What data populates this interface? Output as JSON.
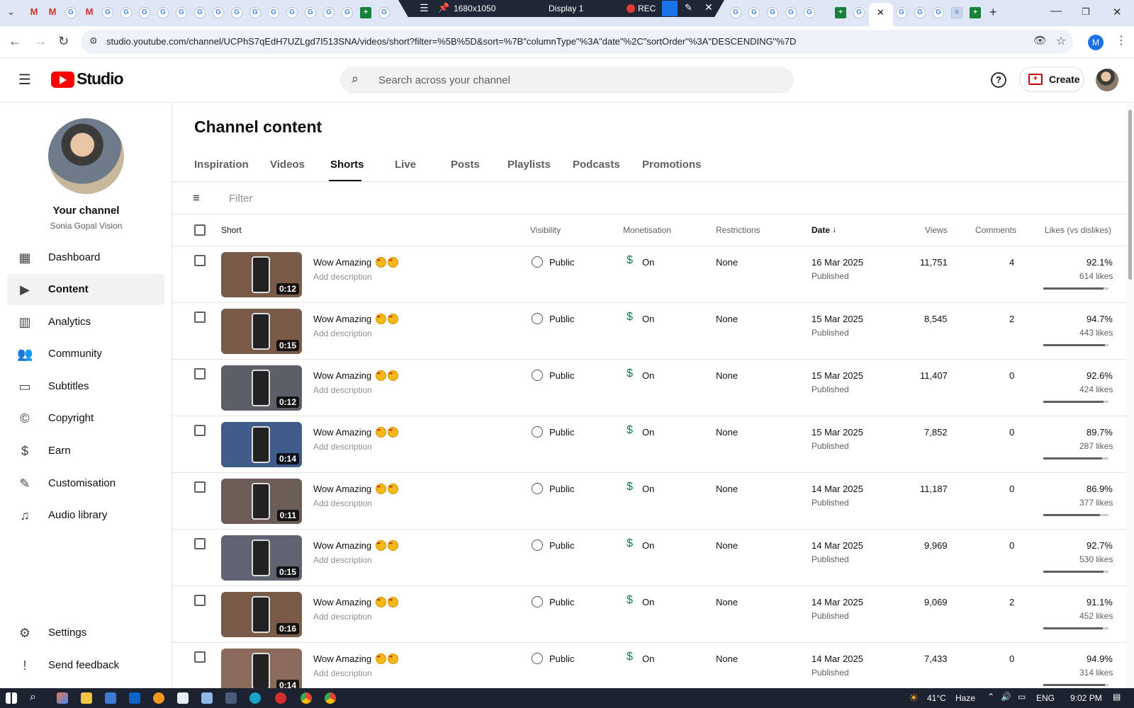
{
  "browser": {
    "rec_bar": {
      "resolution": "1680x1050",
      "display": "Display 1",
      "rec_label": "REC"
    },
    "url": "studio.youtube.com/channel/UCPhS7qEdH7UZLgd7I513SNA/videos/short?filter=%5B%5D&sort=%7B\"columnType\"%3A\"date\"%2C\"sortOrder\"%3A\"DESCENDING\"%7D",
    "profile_initial": "M"
  },
  "header": {
    "logo_text": "Studio",
    "search_placeholder": "Search across your channel",
    "create_label": "Create"
  },
  "sidebar": {
    "your_channel": "Your channel",
    "channel_name": "Sonia Gopal Vision",
    "items": [
      {
        "label": "Dashboard",
        "icon": "dashboard-icon"
      },
      {
        "label": "Content",
        "icon": "content-icon"
      },
      {
        "label": "Analytics",
        "icon": "analytics-icon"
      },
      {
        "label": "Community",
        "icon": "community-icon"
      },
      {
        "label": "Subtitles",
        "icon": "subtitles-icon"
      },
      {
        "label": "Copyright",
        "icon": "copyright-icon"
      },
      {
        "label": "Earn",
        "icon": "earn-icon"
      },
      {
        "label": "Customisation",
        "icon": "customisation-icon"
      },
      {
        "label": "Audio library",
        "icon": "audio-library-icon"
      }
    ],
    "bottom_items": [
      {
        "label": "Settings",
        "icon": "gear-icon"
      },
      {
        "label": "Send feedback",
        "icon": "feedback-icon"
      }
    ]
  },
  "main": {
    "title": "Channel content",
    "tabs": [
      "Inspiration",
      "Videos",
      "Shorts",
      "Live",
      "Posts",
      "Playlists",
      "Podcasts",
      "Promotions"
    ],
    "active_tab": "Shorts",
    "filter_placeholder": "Filter",
    "columns": {
      "short": "Short",
      "visibility": "Visibility",
      "monetisation": "Monetisation",
      "restrictions": "Restrictions",
      "date": "Date",
      "views": "Views",
      "comments": "Comments",
      "likes": "Likes (vs dislikes)"
    },
    "rows": [
      {
        "title": "Wow Amazing",
        "description": "Add description",
        "duration": "0:12",
        "visibility": "Public",
        "monetisation": "On",
        "restrictions": "None",
        "date": "16 Mar 2025",
        "status": "Published",
        "views": "11,751",
        "comments": "4",
        "likes_pct": "92.1%",
        "likes": "614 likes",
        "likes_fraction": 0.921,
        "thumb_color": "#7a5a48"
      },
      {
        "title": "Wow Amazing",
        "description": "Add description",
        "duration": "0:15",
        "visibility": "Public",
        "monetisation": "On",
        "restrictions": "None",
        "date": "15 Mar 2025",
        "status": "Published",
        "views": "8,545",
        "comments": "2",
        "likes_pct": "94.7%",
        "likes": "443 likes",
        "likes_fraction": 0.947,
        "thumb_color": "#7a5a48"
      },
      {
        "title": "Wow Amazing",
        "description": "Add description",
        "duration": "0:12",
        "visibility": "Public",
        "monetisation": "On",
        "restrictions": "None",
        "date": "15 Mar 2025",
        "status": "Published",
        "views": "11,407",
        "comments": "0",
        "likes_pct": "92.6%",
        "likes": "424 likes",
        "likes_fraction": 0.926,
        "thumb_color": "#5c5f68"
      },
      {
        "title": "Wow Amazing",
        "description": "Add description",
        "duration": "0:14",
        "visibility": "Public",
        "monetisation": "On",
        "restrictions": "None",
        "date": "15 Mar 2025",
        "status": "Published",
        "views": "7,852",
        "comments": "0",
        "likes_pct": "89.7%",
        "likes": "287 likes",
        "likes_fraction": 0.897,
        "thumb_color": "#3f5c8a"
      },
      {
        "title": "Wow Amazing",
        "description": "Add description",
        "duration": "0:11",
        "visibility": "Public",
        "monetisation": "On",
        "restrictions": "None",
        "date": "14 Mar 2025",
        "status": "Published",
        "views": "11,187",
        "comments": "0",
        "likes_pct": "86.9%",
        "likes": "377 likes",
        "likes_fraction": 0.869,
        "thumb_color": "#6b5c56"
      },
      {
        "title": "Wow Amazing",
        "description": "Add description",
        "duration": "0:15",
        "visibility": "Public",
        "monetisation": "On",
        "restrictions": "None",
        "date": "14 Mar 2025",
        "status": "Published",
        "views": "9,969",
        "comments": "0",
        "likes_pct": "92.7%",
        "likes": "530 likes",
        "likes_fraction": 0.927,
        "thumb_color": "#5f6470"
      },
      {
        "title": "Wow Amazing",
        "description": "Add description",
        "duration": "0:16",
        "visibility": "Public",
        "monetisation": "On",
        "restrictions": "None",
        "date": "14 Mar 2025",
        "status": "Published",
        "views": "9,069",
        "comments": "2",
        "likes_pct": "91.1%",
        "likes": "452 likes",
        "likes_fraction": 0.911,
        "thumb_color": "#7a5a48"
      },
      {
        "title": "Wow Amazing",
        "description": "Add description",
        "duration": "0:14",
        "visibility": "Public",
        "monetisation": "On",
        "restrictions": "None",
        "date": "14 Mar 2025",
        "status": "Published",
        "views": "7,433",
        "comments": "0",
        "likes_pct": "94.9%",
        "likes": "314 likes",
        "likes_fraction": 0.949,
        "thumb_color": "#8a6a5a"
      }
    ]
  },
  "taskbar": {
    "temperature": "41°C",
    "weather": "Haze",
    "language": "ENG",
    "time": "9:02 PM"
  },
  "colors": {
    "brand_red": "#ff0000",
    "monetisation_green": "#0b8043",
    "rec_red": "#e53935"
  }
}
